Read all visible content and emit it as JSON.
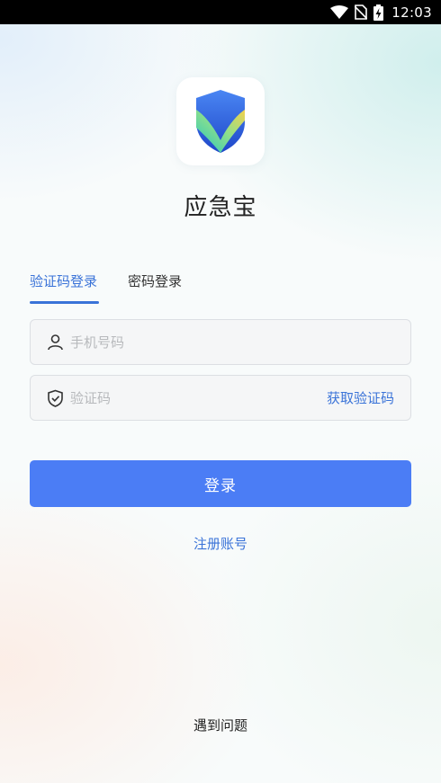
{
  "status_bar": {
    "time": "12:03",
    "icons": [
      "wifi-icon",
      "no-sim-icon",
      "battery-charging-icon"
    ]
  },
  "app": {
    "logo_icon": "shield-check-logo",
    "name": "应急宝"
  },
  "tabs": [
    {
      "label": "验证码登录",
      "active": true
    },
    {
      "label": "密码登录",
      "active": false
    }
  ],
  "form": {
    "phone": {
      "placeholder": "手机号码",
      "value": "",
      "icon": "user-icon"
    },
    "code": {
      "placeholder": "验证码",
      "value": "",
      "icon": "shield-check-icon"
    },
    "get_code_label": "获取验证码"
  },
  "login_button_label": "登录",
  "register_link": "注册账号",
  "help_link": "遇到问题",
  "colors": {
    "accent": "#3a73d8",
    "button": "#4b7df5",
    "status_bar": "#000000"
  }
}
